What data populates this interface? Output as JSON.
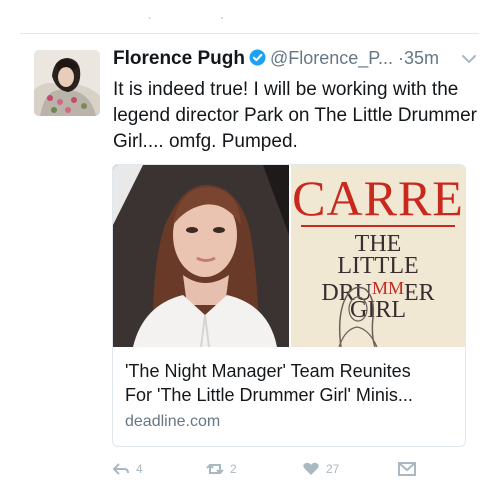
{
  "top_actions": {
    "left_mark": "ˎ",
    "right_mark": "ˏ"
  },
  "tweet": {
    "author_name": "Florence Pugh",
    "handle": "@Florence_P...",
    "separator": "·",
    "time": "35m",
    "text": "It is indeed true! I will be working with the legend director Park on The Little Drummer Girl.... omfg. Pumped.",
    "verified": true,
    "verified_color": "#1da1f2"
  },
  "card": {
    "title_line1": "'The Night Manager' Team Reunites",
    "title_line2": "For 'The Little Drummer Girl' Minis...",
    "domain": "deadline.com",
    "book": {
      "author": "CARRE",
      "title_line1": "THE",
      "title_line2": "LITTLE",
      "title_line3_a": "DRU",
      "title_line3_b": "MM",
      "title_line3_c": "ER",
      "title_line4": "GIRL",
      "accent_color": "#c9281f"
    }
  },
  "actions": {
    "reply_count": "4",
    "retweet_count": "2",
    "like_count": "27"
  },
  "icons": [
    "verified-badge-icon",
    "chevron-down-icon",
    "reply-icon",
    "retweet-icon",
    "like-icon",
    "dm-icon"
  ]
}
